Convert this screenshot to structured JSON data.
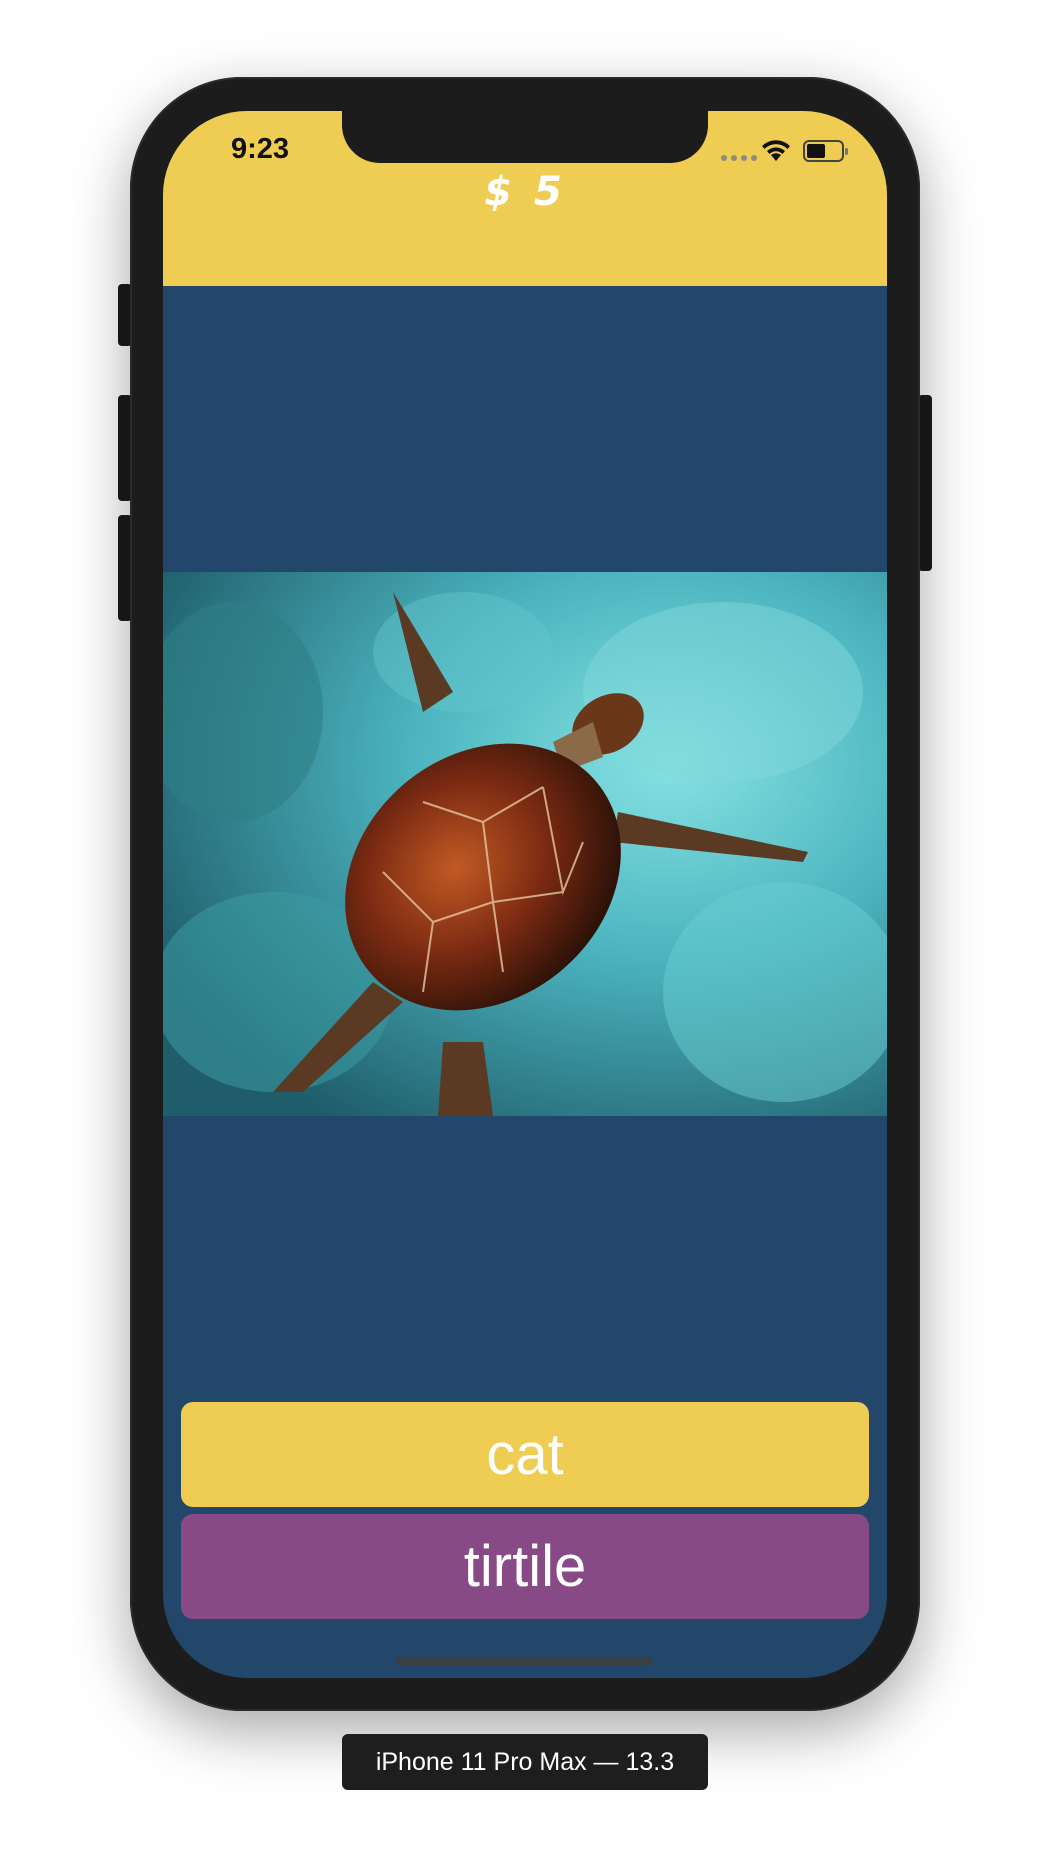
{
  "status_bar": {
    "time": "9:23",
    "icons": [
      "signal-dots-icon",
      "wifi-icon",
      "battery-icon"
    ]
  },
  "header": {
    "score": "$ 5"
  },
  "photo": {
    "subject_icon": "sea-turtle-photo"
  },
  "answers": [
    {
      "label": "cat",
      "color": "#eecd52"
    },
    {
      "label": "tirtile",
      "color": "#874a87"
    }
  ],
  "device_label": "iPhone 11 Pro Max — 13.3",
  "colors": {
    "header": "#eecd52",
    "background": "#22476b",
    "answer_primary": "#eecd52",
    "answer_secondary": "#874a87"
  }
}
